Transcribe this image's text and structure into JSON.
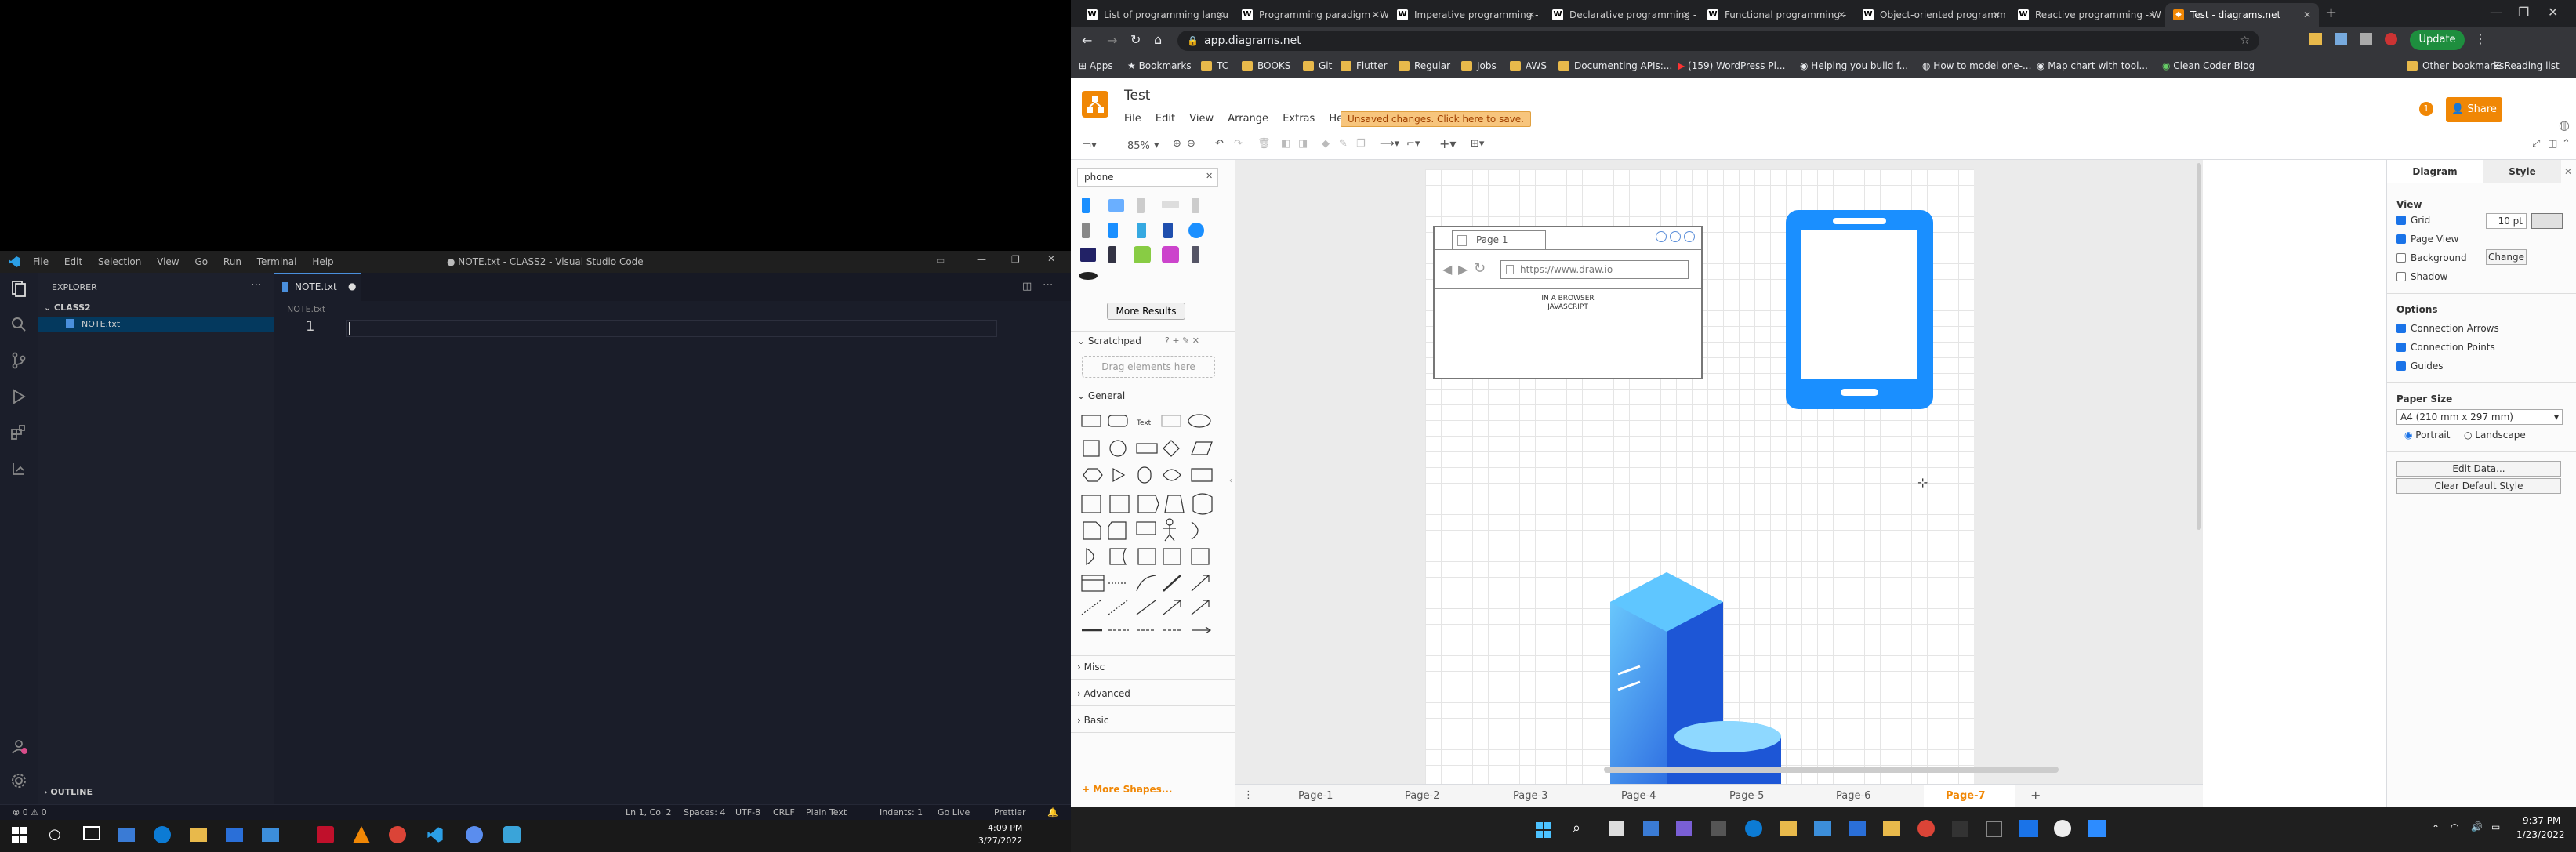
{
  "vscode": {
    "title": "● NOTE.txt - CLASS2 - Visual Studio Code",
    "menu": [
      "File",
      "Edit",
      "Selection",
      "View",
      "Go",
      "Run",
      "Terminal",
      "Help"
    ],
    "explorer_label": "EXPLORER",
    "folder": "CLASS2",
    "file": "NOTE.txt",
    "tab_label": "NOTE.txt",
    "breadcrumb": "NOTE.txt",
    "line_number": "1",
    "outline_label": "OUTLINE",
    "status": {
      "problems": "⊗ 0 ⚠ 0",
      "position": "Ln 1, Col 2",
      "spaces": "Spaces: 4",
      "encoding": "UTF-8",
      "eol": "CRLF",
      "language": "Plain Text",
      "indents": "Indents: 1",
      "golive": "Go Live",
      "prettier": "Prettier"
    },
    "clock": {
      "time": "4:09 PM",
      "date": "3/27/2022"
    }
  },
  "chrome": {
    "tabs": [
      "List of programming langu",
      "Programming paradigm - W",
      "Imperative programming -",
      "Declarative programming -",
      "Functional programming -",
      "Object-oriented programm",
      "Reactive programming - W",
      "Test - diagrams.net"
    ],
    "url": "app.diagrams.net",
    "update_label": "Update",
    "bookmarks": [
      "Apps",
      "Bookmarks",
      "TC",
      "BOOKS",
      "Git",
      "Flutter",
      "Regular",
      "Jobs",
      "AWS",
      "Documenting APIs:...",
      "(159) WordPress Pl...",
      "Helping you build f...",
      "How to model one-...",
      "Map chart with tool...",
      "Clean Coder Blog",
      "Other bookmarks",
      "Reading list"
    ]
  },
  "drawio": {
    "title": "Test",
    "menu": [
      "File",
      "Edit",
      "View",
      "Arrange",
      "Extras",
      "Help"
    ],
    "unsaved": "Unsaved changes. Click here to save.",
    "share": "Share",
    "notif_count": "1",
    "zoom": "85%",
    "search_value": "phone",
    "more_results": "More Results",
    "scratchpad": "Scratchpad",
    "drag_here": "Drag elements here",
    "categories": [
      "General",
      "Misc",
      "Advanced",
      "Basic"
    ],
    "more_shapes": "+ More Shapes...",
    "canvas": {
      "browser_tab": "Page 1",
      "browser_url": "https://www.draw.io",
      "browser_text": [
        "IN A BROWSER",
        "JAVASCRIPT"
      ]
    },
    "pages": [
      "Page-1",
      "Page-2",
      "Page-3",
      "Page-4",
      "Page-5",
      "Page-6",
      "Page-7"
    ],
    "format": {
      "tabs": [
        "Diagram",
        "Style"
      ],
      "view_label": "View",
      "grid": "Grid",
      "grid_size": "10 pt",
      "page_view": "Page View",
      "background": "Background",
      "change": "Change",
      "shadow": "Shadow",
      "options_label": "Options",
      "connection_arrows": "Connection Arrows",
      "connection_points": "Connection Points",
      "guides": "Guides",
      "paper_size_label": "Paper Size",
      "paper_size": "A4 (210 mm x 297 mm)",
      "portrait": "Portrait",
      "landscape": "Landscape",
      "edit_data": "Edit Data...",
      "clear_style": "Clear Default Style"
    }
  },
  "taskbar": {
    "time": "9:37 PM",
    "date": "1/23/2022"
  },
  "colors": {
    "drawio_orange": "#f08705",
    "phone_blue": "#1a8fff",
    "vscode_bg": "#1a1d29"
  }
}
